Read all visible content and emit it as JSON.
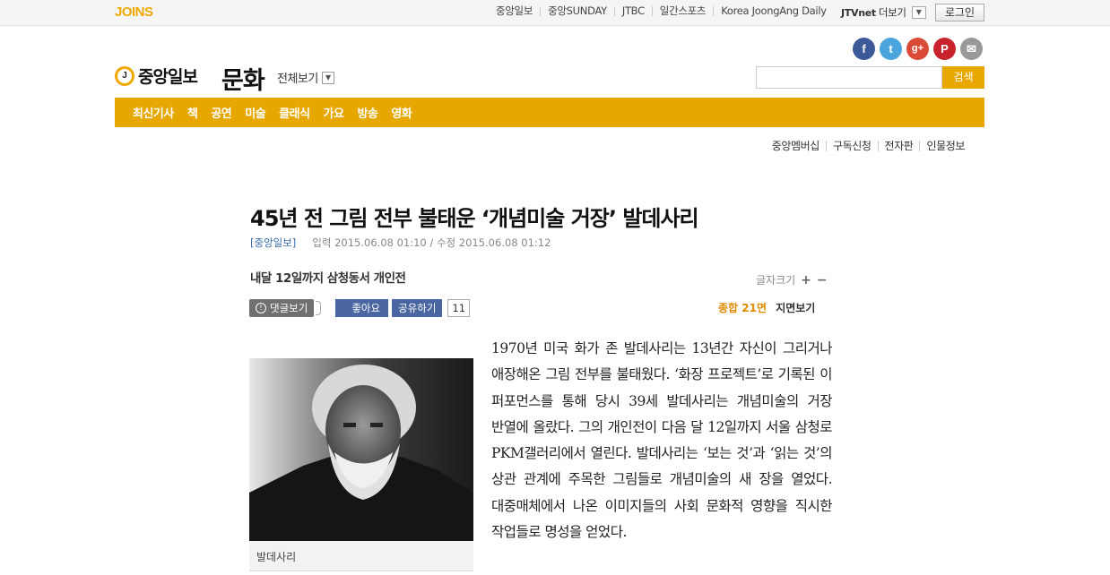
{
  "topbar": {
    "brand": "JOINS",
    "links": [
      "중앙일보",
      "중앙SUNDAY",
      "JTBC",
      "일간스포츠",
      "Korea JoongAng Daily"
    ],
    "jtv": "JTVnet",
    "more_label": "더보기",
    "login_label": "로그인"
  },
  "header": {
    "logo_mark": "J",
    "logo_text": "중앙일보",
    "section_title": "문화",
    "view_all_label": "전체보기",
    "search_placeholder": "",
    "search_button": "검색",
    "social": [
      {
        "name": "facebook-icon",
        "glyph": "f",
        "color": "#3b5998"
      },
      {
        "name": "twitter-icon",
        "glyph": "t",
        "color": "#4aa5dc"
      },
      {
        "name": "google-plus-icon",
        "glyph": "g+",
        "color": "#d94a38"
      },
      {
        "name": "pinterest-icon",
        "glyph": "P",
        "color": "#c8232c"
      },
      {
        "name": "mail-icon",
        "glyph": "✉",
        "color": "#999999"
      }
    ]
  },
  "nav": {
    "items": [
      "최신기사",
      "책",
      "공연",
      "미술",
      "클래식",
      "가요",
      "방송",
      "영화"
    ],
    "accent_color": "#e6a700"
  },
  "sub_links": [
    "중앙멤버십",
    "구독신청",
    "전자판",
    "인물정보"
  ],
  "article": {
    "headline": "45년 전 그림 전부 불태운 ‘개념미술 거장’ 발데사리",
    "source": "[중앙일보]",
    "dates": "입력 2015.06.08 01:10 / 수정 2015.06.08 01:12",
    "subhead": "내달 12일까지 삼청동서 개인전",
    "font_size_label": "글자크기",
    "font_plus": "+",
    "font_minus": "−",
    "comment_label": "댓글보기",
    "like_label": "좋아요",
    "share_label": "공유하기",
    "share_count": "11",
    "page_label": "종합 21면",
    "page_view_label": "지면보기",
    "photo_caption": "발데사리",
    "body": "1970년 미국 화가 존 발데사리는 13년간 자신이 그리거나 애장해온 그림 전부를 불태웠다. ‘화장 프로젝트’로 기록된 이 퍼포먼스를 통해 당시 39세 발데사리는 개념미술의 거장 반열에 올랐다. 그의 개인전이 다음 달 12일까지 서울 삼청로 PKM갤러리에서 열린다. 발데사리는 ‘보는 것’과 ‘읽는 것’의 상관 관계에 주목한 그림들로 개념미술의 새 장을 열었다. 대중매체에서 나온 이미지들의 사회 문화적 영향을 직시한 작업들로 명성을 얻었다."
  }
}
